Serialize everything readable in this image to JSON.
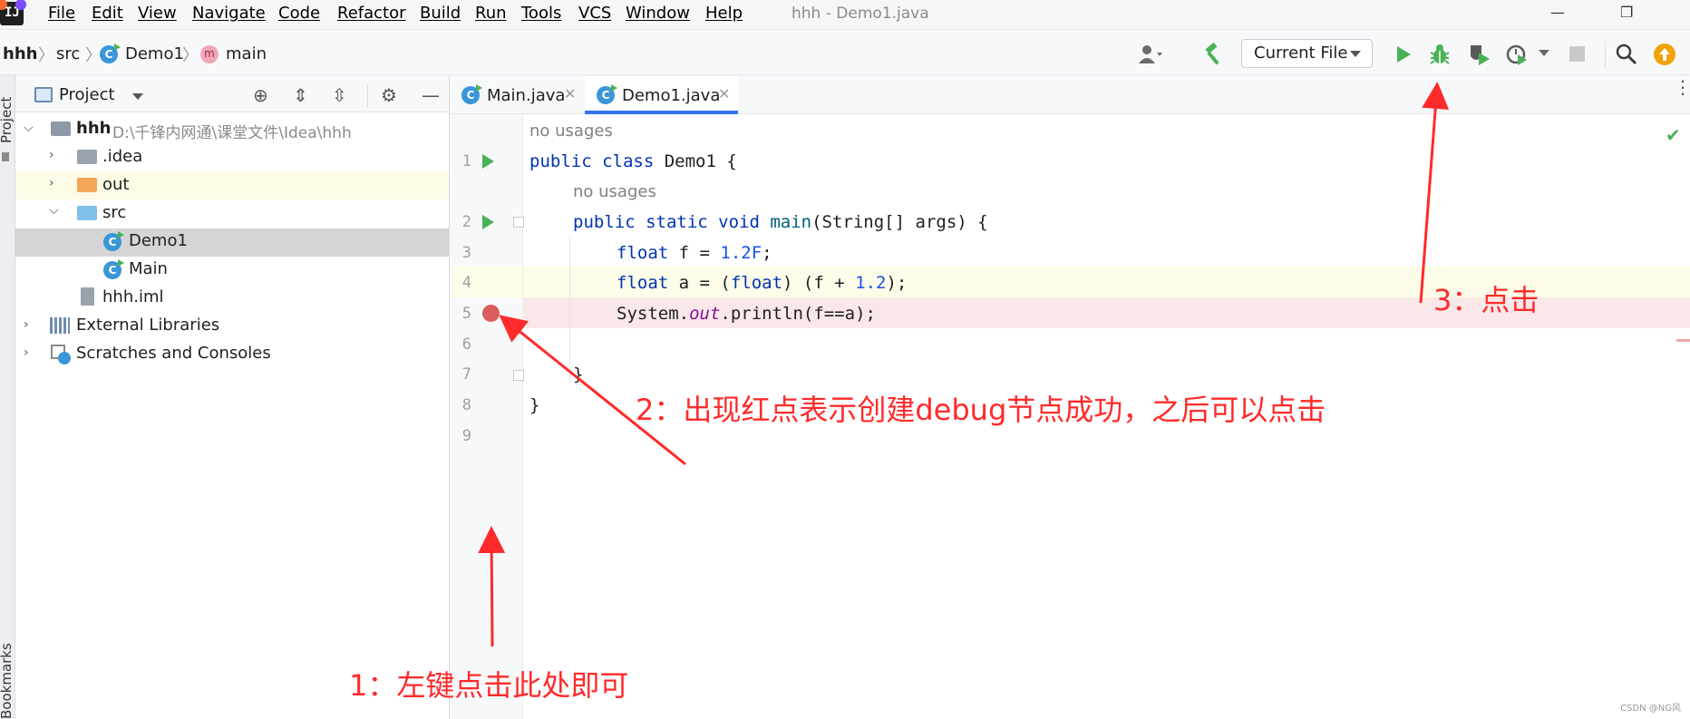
{
  "app": {
    "logo_text": "IJ"
  },
  "menu": [
    "File",
    "Edit",
    "View",
    "Navigate",
    "Code",
    "Refactor",
    "Build",
    "Run",
    "Tools",
    "VCS",
    "Window",
    "Help"
  ],
  "window_title": "hhh - Demo1.java",
  "breadcrumb": {
    "project": "hhh",
    "folder": "src",
    "class": "Demo1",
    "method": "main"
  },
  "toolbar": {
    "run_config": "Current File",
    "icons": [
      "account-icon",
      "build-hammer-icon",
      "run-icon",
      "debug-bug-icon",
      "coverage-icon",
      "profile-icon",
      "stop-icon",
      "search-icon",
      "update-icon"
    ]
  },
  "side_strip": {
    "top_label": "Project",
    "bottom_label": "Bookmarks"
  },
  "project_panel": {
    "title": "Project",
    "tree": [
      {
        "label": "hhh",
        "path": "D:\\千锋内网通\\课堂文件\\Idea\\hhh"
      },
      {
        "label": ".idea"
      },
      {
        "label": "out"
      },
      {
        "label": "src"
      },
      {
        "label": "Demo1"
      },
      {
        "label": "Main"
      },
      {
        "label": "hhh.iml"
      },
      {
        "label": "External Libraries"
      },
      {
        "label": "Scratches and Consoles"
      }
    ]
  },
  "tabs": [
    {
      "label": "Main.java"
    },
    {
      "label": "Demo1.java",
      "active": true
    }
  ],
  "editor": {
    "hint_no_usages": "no usages",
    "line_numbers": [
      "1",
      "2",
      "3",
      "4",
      "5",
      "6",
      "7",
      "8",
      "9"
    ],
    "code": {
      "l1_kw": "public class",
      "l1_rest": " Demo1 {",
      "l2_kw": "public static void",
      "l2_name": " main",
      "l2_rest": "(String[] args) {",
      "l3_kw": "float",
      "l3_mid": " f = ",
      "l3_num": "1.2F",
      "l3_end": ";",
      "l4_kw": "float",
      "l4_mid": " a = (",
      "l4_kw2": "float",
      "l4_mid2": ") (f + ",
      "l4_num": "1.2",
      "l4_end": ");",
      "l5_pre": "System.",
      "l5_fld": "out",
      "l5_end": ".println(f==a);",
      "l7": "}",
      "l8": "}"
    }
  },
  "annotations": {
    "a1": "1：左键点击此处即可",
    "a2": "2：出现红点表示创建debug节点成功，之后可以点击",
    "a3": "3：点击"
  },
  "watermark": "CSDN @NG风",
  "colors": {
    "annotation_red": "#ff2a2a",
    "breakpoint": "#db5c5c",
    "run_green": "#4ab157",
    "accent_blue": "#3574f0"
  }
}
